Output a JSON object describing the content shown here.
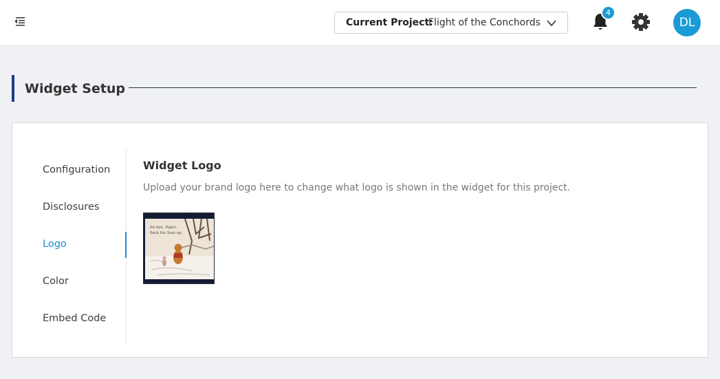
{
  "header": {
    "project_label": "Current Project:",
    "project_name": "Flight of the Conchords",
    "notification_count": "4",
    "avatar_initials": "DL"
  },
  "section": {
    "title": "Widget Setup"
  },
  "nav": {
    "items": [
      {
        "label": "Configuration"
      },
      {
        "label": "Disclosures"
      },
      {
        "label": "Logo"
      },
      {
        "label": "Color"
      },
      {
        "label": "Embed Code"
      }
    ],
    "active": "Logo"
  },
  "content": {
    "heading": "Widget Logo",
    "description": "Upload your brand logo here to change what logo is shown in the widget for this project.",
    "logo_caption": "Sit feet, Piglet. Back the Saze up."
  },
  "colors": {
    "accent": "#1a9ad6",
    "active_nav": "#1a8ad0",
    "header_bar": "#1f3b8c"
  }
}
